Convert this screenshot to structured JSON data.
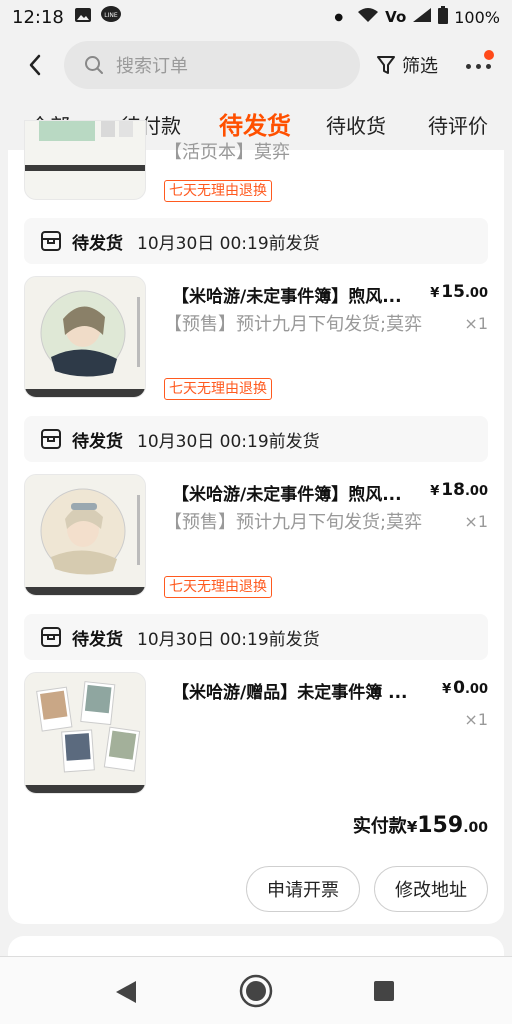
{
  "status_bar": {
    "time": "12:18",
    "battery": "100%",
    "icons": [
      "image-icon",
      "line-app-icon",
      "dot-icon",
      "wifi-icon",
      "volte-icon",
      "signal-icon",
      "battery-icon"
    ]
  },
  "header": {
    "search_placeholder": "搜索订单",
    "filter_label": "筛选"
  },
  "tabs": [
    "全部",
    "待付款",
    "待发货",
    "待收货",
    "待评价"
  ],
  "active_tab": "待发货",
  "top_partial_item": {
    "subtitle": "【活页本】莫弈",
    "badge": "七天无理由退换"
  },
  "items": [
    {
      "ship_status": "待发货",
      "ship_time": "10月30日 00:19前发货",
      "title": "【米哈游/未定事件簿】煦风...",
      "subtitle": "【预售】预计九月下旬发货;莫弈",
      "price_int": "15",
      "price_dec": ".00",
      "qty": "×1",
      "badge": "七天无理由退换"
    },
    {
      "ship_status": "待发货",
      "ship_time": "10月30日 00:19前发货",
      "title": "【米哈游/未定事件簿】煦风...",
      "subtitle": "【预售】预计九月下旬发货;莫弈",
      "price_int": "18",
      "price_dec": ".00",
      "qty": "×1",
      "badge": "七天无理由退换"
    },
    {
      "ship_status": "待发货",
      "ship_time": "10月30日 00:19前发货",
      "title": "【米哈游/赠品】未定事件簿 ...",
      "subtitle": "",
      "price_int": "0",
      "price_dec": ".00",
      "qty": "×1",
      "badge": ""
    }
  ],
  "currency": "¥",
  "total": {
    "label": "实付款",
    "currency": "¥",
    "amount_int": "159",
    "amount_dec": ".00"
  },
  "actions": {
    "invoice": "申请开票",
    "change_address": "修改地址"
  },
  "colors": {
    "accent": "#ff5000",
    "badge": "#ff5a1f",
    "muted": "#999999"
  }
}
